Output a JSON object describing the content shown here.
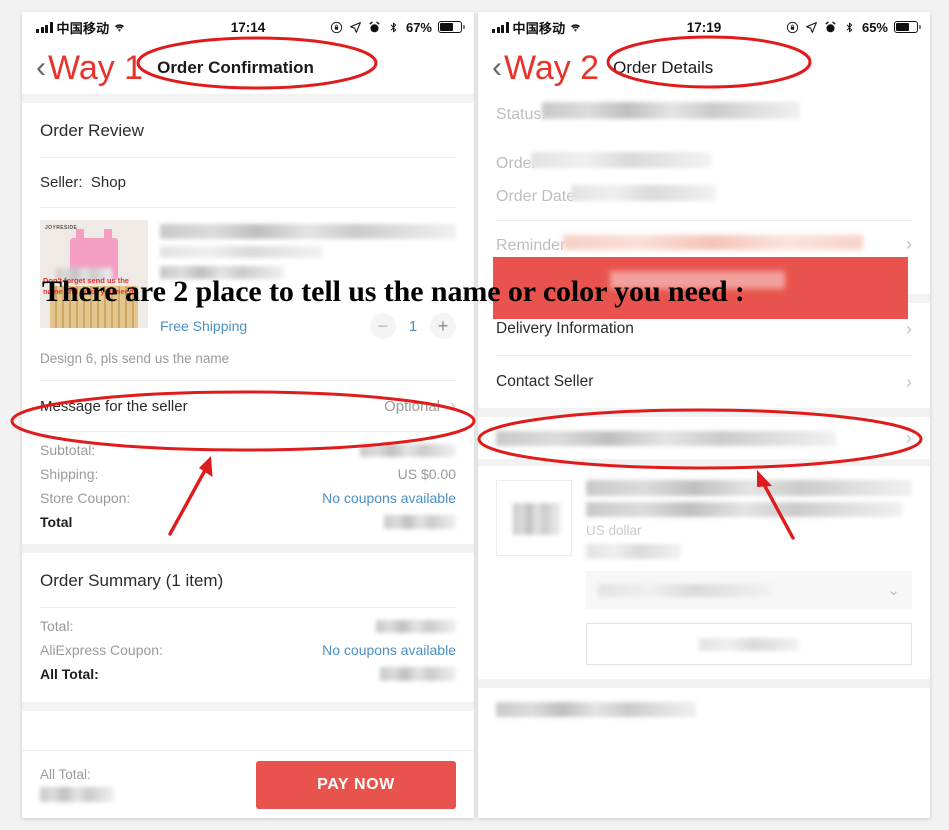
{
  "annotation": {
    "headline": "There are 2 place to tell us the name or color you need :",
    "highlight_color": "#e8544d",
    "marker_color": "#e01b1b"
  },
  "left_panel": {
    "status_bar": {
      "carrier": "中国移动",
      "time": "17:14",
      "battery_percent": "67%",
      "icons": [
        "signal-bars-icon",
        "wifi-icon",
        "lock-rotation-icon",
        "location-arrow-icon",
        "alarm-clock-icon",
        "bluetooth-icon",
        "battery-icon"
      ]
    },
    "nav": {
      "back_icon": "chevron-left-icon",
      "way_label": "Way 1",
      "title": "Order Confirmation"
    },
    "order_review": {
      "section_title": "Order Review",
      "seller_label": "Seller:",
      "seller_name": "Shop",
      "item": {
        "thumb_brand": "JOYRESIDE",
        "thumb_caption": "Don't forget send us the name and color you need!",
        "free_shipping": "Free Shipping",
        "quantity": "1",
        "minus_icon": "minus-icon",
        "plus_icon": "plus-icon",
        "design_note": "Design 6, pls send us the name"
      },
      "message_row": {
        "label": "Message for the seller",
        "value": "Optional",
        "chevron": "chevron-right-icon"
      },
      "prices": [
        {
          "label": "Subtotal:",
          "value": "",
          "blurred": true
        },
        {
          "label": "Shipping:",
          "value": "US $0.00",
          "blurred": false
        },
        {
          "label": "Store Coupon:",
          "value": "No coupons available",
          "blurred": false,
          "link": true
        },
        {
          "label": "Total",
          "value": "",
          "blurred": true,
          "bold": true
        }
      ]
    },
    "order_summary": {
      "section_title": "Order Summary (1 item)",
      "rows": [
        {
          "label": "Total:",
          "value": "",
          "blurred": true
        },
        {
          "label": "AliExpress Coupon:",
          "value": "No coupons available",
          "blurred": false,
          "link": true
        },
        {
          "label": "All Total:",
          "value": "",
          "blurred": true,
          "bold": true
        }
      ]
    },
    "pay_bar": {
      "total_label": "All Total:",
      "total_value": "",
      "pay_button": "PAY NOW"
    }
  },
  "right_panel": {
    "status_bar": {
      "carrier": "中国移动",
      "time": "17:19",
      "battery_percent": "65%",
      "icons": [
        "signal-bars-icon",
        "wifi-icon",
        "lock-rotation-icon",
        "location-arrow-icon",
        "alarm-clock-icon",
        "bluetooth-icon",
        "battery-icon"
      ]
    },
    "nav": {
      "back_icon": "chevron-left-icon",
      "way_label": "Way 2",
      "title": "Order Details"
    },
    "fields": [
      {
        "label": "Status:",
        "value": "",
        "blurred": true
      },
      {
        "label": "Order",
        "value": "",
        "blurred": true
      },
      {
        "label": "Order Date",
        "value": "",
        "blurred": true
      },
      {
        "label": "Reminder",
        "value": "",
        "blurred": true
      }
    ],
    "rows": [
      {
        "label": "Delivery Information",
        "chevron": "chevron-right-icon"
      },
      {
        "label": "Contact Seller",
        "chevron": "chevron-right-icon"
      }
    ],
    "product": {
      "price_text": "US dollar",
      "select_chevron": "chevron-down-icon"
    }
  }
}
